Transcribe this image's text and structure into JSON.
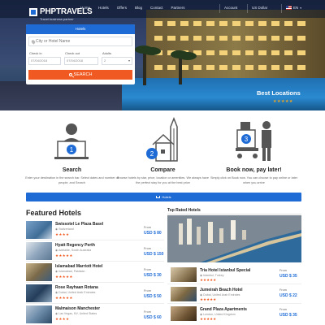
{
  "colors": {
    "primary": "#1e6bd6",
    "accent": "#f05a22",
    "star": "#f4a51c"
  },
  "header": {
    "logo_text": "PHPTRAVELS",
    "logo_sub": "Travel business partner",
    "nav": [
      "Home",
      "Hotels",
      "Offers",
      "Blog",
      "Contact",
      "Partners"
    ],
    "account": "Account",
    "currency": "US Dollar",
    "language": "EN"
  },
  "search": {
    "tab_label": "Hotels",
    "city_placeholder": "City or Hotel Name",
    "checkin_label": "Check in",
    "checkin_value": "07/04/2018",
    "checkout_label": "Check out",
    "checkout_value": "07/04/2018",
    "adults_label": "Adults",
    "adults_value": "2",
    "button_label": "SEARCH"
  },
  "hero": {
    "caption": "Best Locations",
    "stars": "★★★★★"
  },
  "features": [
    {
      "title": "Search",
      "desc": "Enter your destination in the search bar. Select dates and number of people, and Search",
      "badge": "1"
    },
    {
      "title": "Compare",
      "desc": "Browse hotels by star, price, location or amenities. We always have the perfect stay for you at the best price",
      "badge": "2"
    },
    {
      "title": "Book now, pay later!",
      "desc": "Simply click on Book now. You can choose to pay online or later when you arrive",
      "badge": "3"
    }
  ],
  "hotels_bar": "Hotels",
  "featured": {
    "title": "Featured Hotels",
    "from_label": "From",
    "items": [
      {
        "name": "Swissotel Le Plaza Basel",
        "location": "Switzerland",
        "stars": "★★★★",
        "price": "USD $ 80"
      },
      {
        "name": "Hyatt Regency Perth",
        "location": "Adelaide, South Australia",
        "stars": "★★★★★",
        "price": "USD $ 150"
      },
      {
        "name": "Islamabad Marriott Hotel",
        "location": "Islamabad, Pakistan",
        "stars": "★★★★★",
        "price": "USD $ 30"
      },
      {
        "name": "Rose Rayhaan Rotana",
        "location": "Dubai, United Arab Emirates",
        "stars": "★★★★★",
        "price": "USD $ 50"
      },
      {
        "name": "Malmaison Manchester",
        "location": "Las Vegas, NV, United States",
        "stars": "★★★★",
        "price": "USD $ 60"
      }
    ]
  },
  "top_rated": {
    "title": "Top Rated Hotels",
    "from_label": "From",
    "items": [
      {
        "name": "Tria Hotel Istanbul Special",
        "location": "Istanbul, Turkey",
        "stars": "★★★★★",
        "price": "USD $ 35"
      },
      {
        "name": "Jumeirah Beach Hotel",
        "location": "Dubai, United Arab Emirates",
        "stars": "★★★★★",
        "price": "USD $ 22"
      },
      {
        "name": "Grand Plaza Apartments",
        "location": "London, United Kingdom",
        "stars": "★★★★★",
        "price": "USD $ 35"
      }
    ]
  }
}
